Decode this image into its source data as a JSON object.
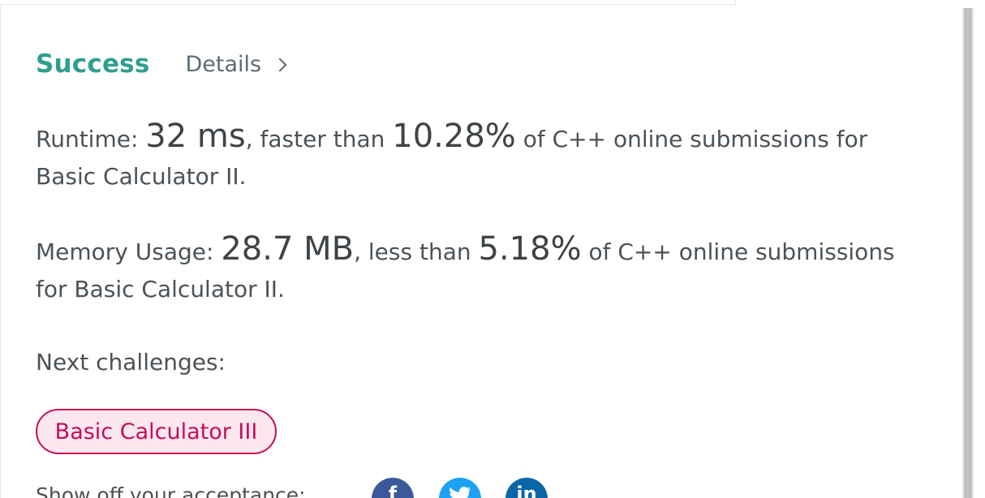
{
  "status": {
    "result": "Success",
    "details_link": "Details"
  },
  "runtime": {
    "label": "Runtime: ",
    "value": "32 ms",
    "comparison": ", faster than ",
    "percentage": "10.28%",
    "suffix": " of C++ online submissions for Basic Calculator II."
  },
  "memory": {
    "label": "Memory Usage: ",
    "value": "28.7 MB",
    "comparison": ", less than ",
    "percentage": "5.18%",
    "suffix": " of C++ online submissions for Basic Calculator II."
  },
  "next": {
    "title": "Next challenges:",
    "challenges": [
      {
        "label": "Basic Calculator III"
      }
    ]
  },
  "share": {
    "text": "Show off your acceptance:",
    "icons": [
      "facebook-icon",
      "twitter-icon",
      "linkedin-icon"
    ],
    "colors": {
      "facebook": "#3b5998",
      "twitter": "#1da1f2",
      "linkedin": "#0a66a8"
    }
  },
  "colors": {
    "success": "#2f9e8f",
    "challenge_border": "#c40e5a",
    "challenge_background": "#fde7ef"
  }
}
